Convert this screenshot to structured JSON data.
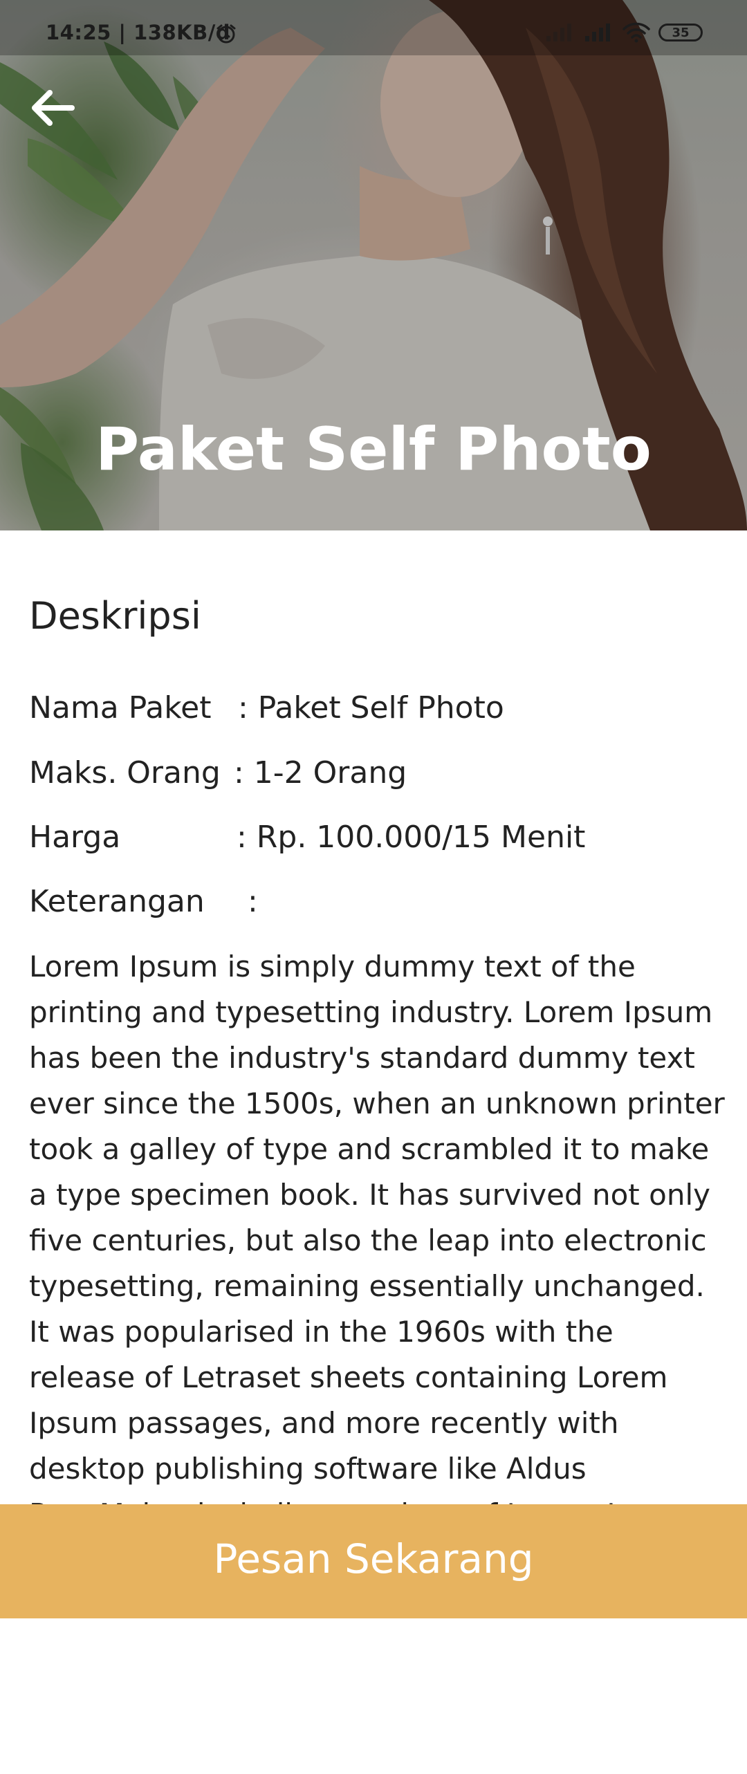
{
  "status_bar": {
    "time_text": "14:25 | 138KB/d",
    "battery": "35",
    "icons": [
      "alarm-icon",
      "signal-icon",
      "signal-icon",
      "wifi-icon",
      "battery-icon"
    ]
  },
  "header": {
    "back_icon": "arrow-left-icon",
    "title": "Paket Self Photo"
  },
  "description": {
    "heading": "Deskripsi",
    "details": [
      {
        "label": "Nama Paket",
        "value": ": Paket Self Photo"
      },
      {
        "label": "Maks. Orang",
        "value": ": 1-2 Orang"
      },
      {
        "label": "Harga",
        "value": ": Rp. 100.000/15 Menit"
      },
      {
        "label": "Keterangan",
        "value": ":"
      }
    ],
    "body": "Lorem Ipsum is simply dummy text of the printing and typesetting industry. Lorem Ipsum has been the industry's standard dummy text ever since the 1500s, when an unknown printer took a galley of type and scrambled it to make a type specimen book. It has survived not only five centuries, but also the leap into electronic typesetting, remaining essentially unchanged. It was popularised in the 1960s with the release of Letraset sheets containing Lorem Ipsum passages, and more recently with desktop publishing software like Aldus PageMaker including versions of Lorem Ipsum."
  },
  "footer": {
    "order_label": "Pesan Sekarang"
  },
  "colors": {
    "accent": "#e7b35f",
    "text": "#222222",
    "hero_title": "#ffffff"
  }
}
